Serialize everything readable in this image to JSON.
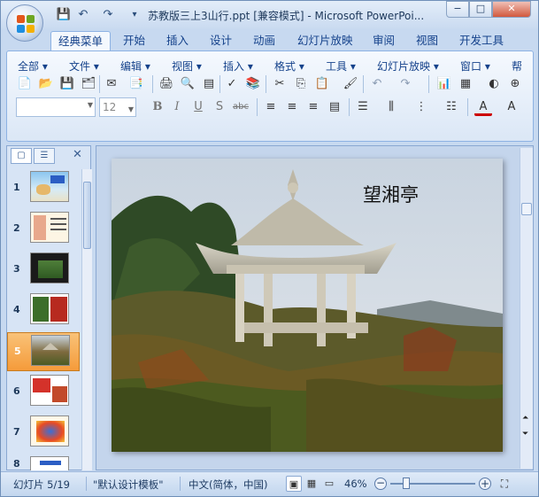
{
  "window": {
    "title": "苏教版三上3山行.ppt [兼容模式] - Microsoft PowerPoi...",
    "minimize": "−",
    "maximize": "□",
    "close": "✕"
  },
  "qat": {
    "save_icon": "💾",
    "undo_icon": "↶",
    "redo_icon": "↷",
    "customize_icon": "▾"
  },
  "tabs": [
    {
      "label": "经典菜单",
      "active": true
    },
    {
      "label": "开始"
    },
    {
      "label": "插入"
    },
    {
      "label": "设计"
    },
    {
      "label": "动画"
    },
    {
      "label": "幻灯片放映"
    },
    {
      "label": "审阅"
    },
    {
      "label": "视图"
    },
    {
      "label": "开发工具"
    }
  ],
  "menus": [
    "全部 ▾",
    "文件 ▾",
    "编辑 ▾",
    "视图 ▾",
    "插入 ▾",
    "格式 ▾",
    "工具 ▾",
    "幻灯片放映 ▾",
    "窗口 ▾",
    "帮"
  ],
  "font": {
    "name": "",
    "size": "12"
  },
  "format_buttons": {
    "bold": "B",
    "italic": "I",
    "underline": "U",
    "shadow": "S",
    "strike": "abc",
    "font_color": "A",
    "grow": "A"
  },
  "slides_pane": {
    "close": "✕",
    "slide_count": 8,
    "selected": 5,
    "numbers": [
      "1",
      "2",
      "3",
      "4",
      "5",
      "6",
      "7",
      "8"
    ]
  },
  "slide": {
    "title": "望湘亭"
  },
  "status": {
    "slide_pos": "幻灯片 5/19",
    "theme": "\"默认设计模板\"",
    "language": "中文(简体，中国)",
    "zoom": "46%",
    "zoom_minus": "−",
    "zoom_plus": "+"
  }
}
